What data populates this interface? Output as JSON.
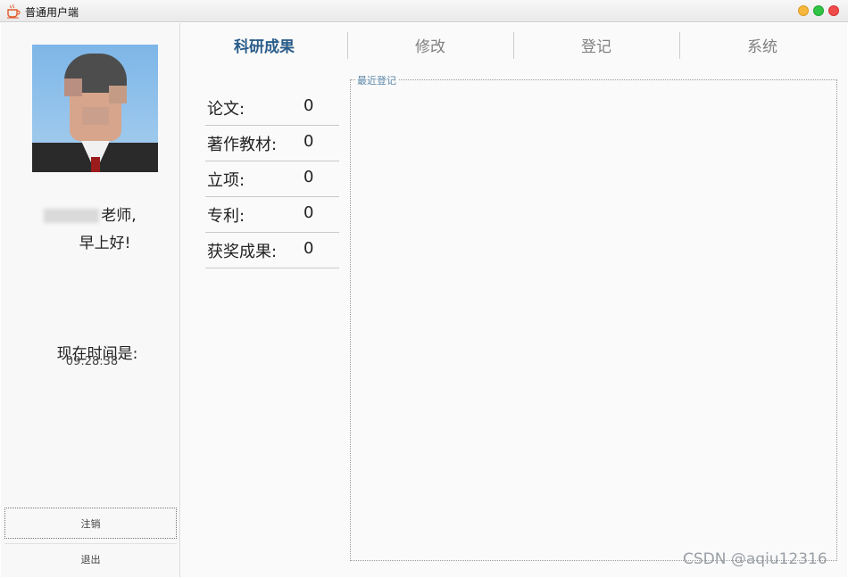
{
  "window": {
    "title": "普通用户端"
  },
  "sidebar": {
    "greeting_suffix": "老师,",
    "greeting": "早上好!",
    "time_label": "现在时间是:",
    "time_value": "09:28:38",
    "logout_label": "注销",
    "exit_label": "退出"
  },
  "tabs": [
    {
      "label": "科研成果"
    },
    {
      "label": "修改"
    },
    {
      "label": "登记"
    },
    {
      "label": "系统"
    }
  ],
  "stats": [
    {
      "label": "论文:",
      "value": "0"
    },
    {
      "label": "著作教材:",
      "value": "0"
    },
    {
      "label": "立项:",
      "value": "0"
    },
    {
      "label": "专利:",
      "value": "0"
    },
    {
      "label": "获奖成果:",
      "value": "0"
    }
  ],
  "recent": {
    "title": "最近登记"
  },
  "watermark": "CSDN @aqiu12316",
  "colors": {
    "active_tab": "#2a5d8a",
    "inactive_tab": "#808080",
    "recent_title": "#5a86a8"
  }
}
